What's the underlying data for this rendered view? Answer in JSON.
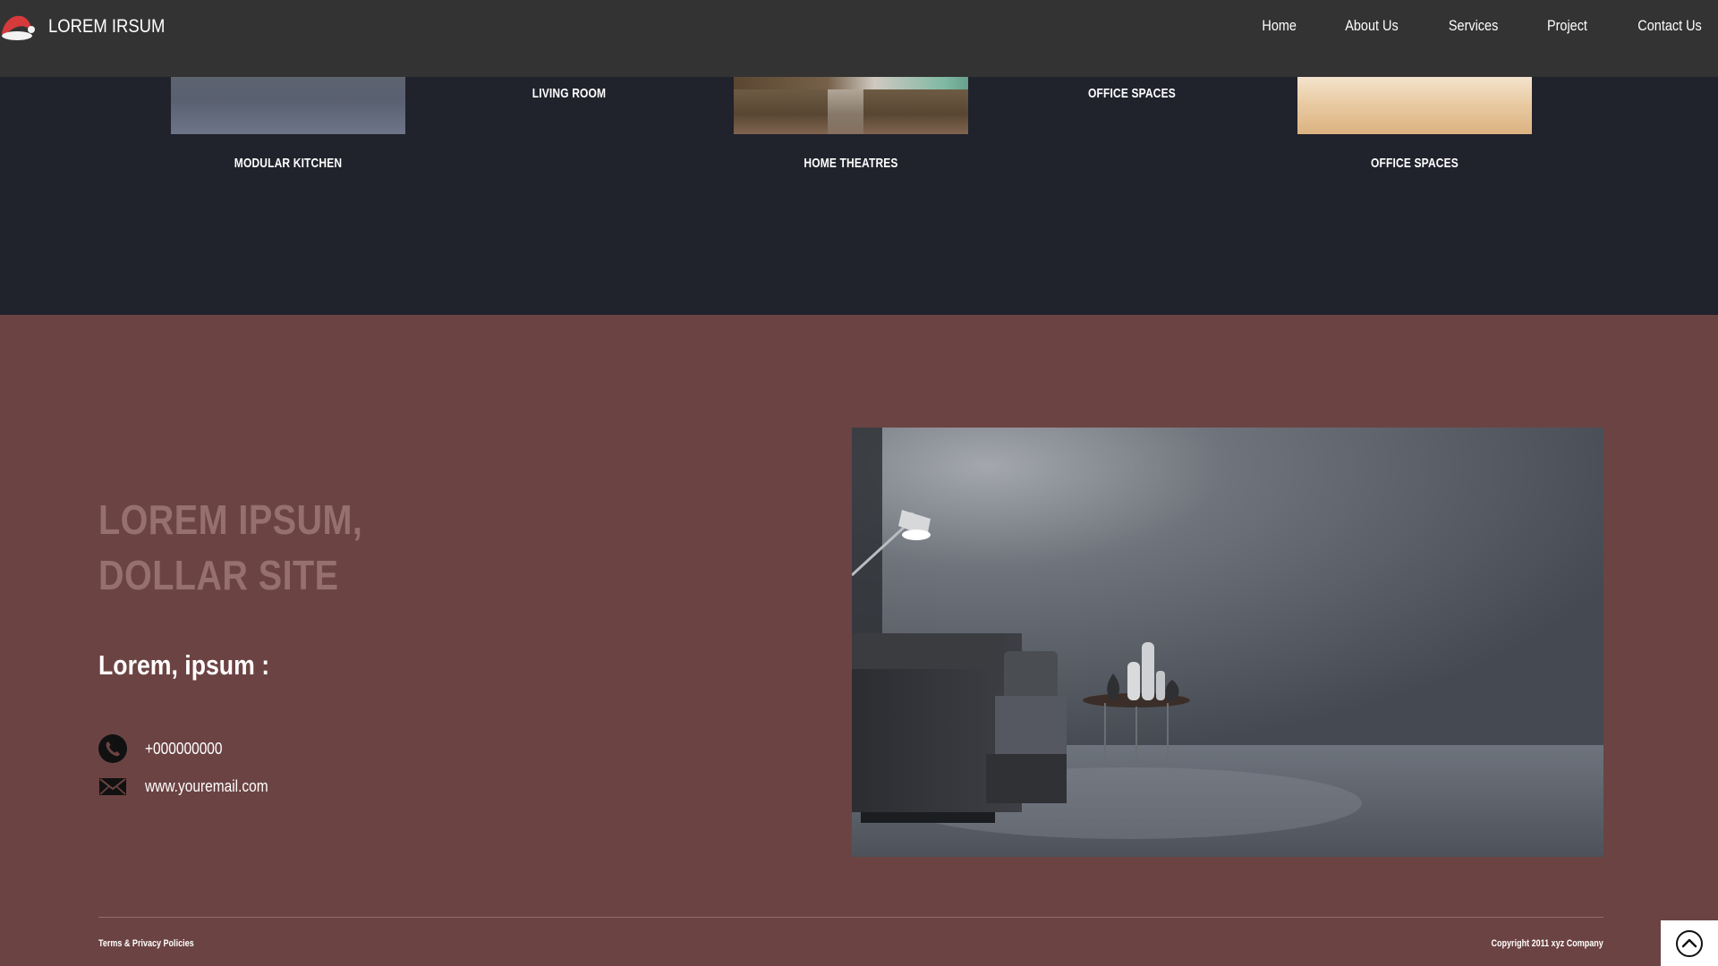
{
  "brand": {
    "name": "LOREM IRSUM",
    "logo_icon": "santa-hat-icon"
  },
  "nav": {
    "items": [
      {
        "label": "Home"
      },
      {
        "label": "About Us"
      },
      {
        "label": "Services"
      },
      {
        "label": "Project"
      },
      {
        "label": "Contact Us"
      }
    ]
  },
  "services": {
    "row1_labels": [
      "LIVING ROOM",
      "OFFICE SPACES"
    ],
    "row2_labels": [
      "MODULAR KITCHEN",
      "HOME THEATRES",
      "OFFICE SPACES"
    ]
  },
  "contact": {
    "headline": "LOREM IPSUM, DOLLAR SITE",
    "subheading": "Lorem, ipsum :",
    "phone": "+000000000",
    "email": "www.youremail.com",
    "phone_icon": "phone-icon",
    "email_icon": "envelope-icon"
  },
  "footer": {
    "left": "Terms & Privacy Policies",
    "right": "Copyright 2011 xyz Company"
  },
  "colors": {
    "navbar": "#333333",
    "services_bg": "#20222c",
    "contact_bg": "#6c4343",
    "headline": "#95706f"
  }
}
